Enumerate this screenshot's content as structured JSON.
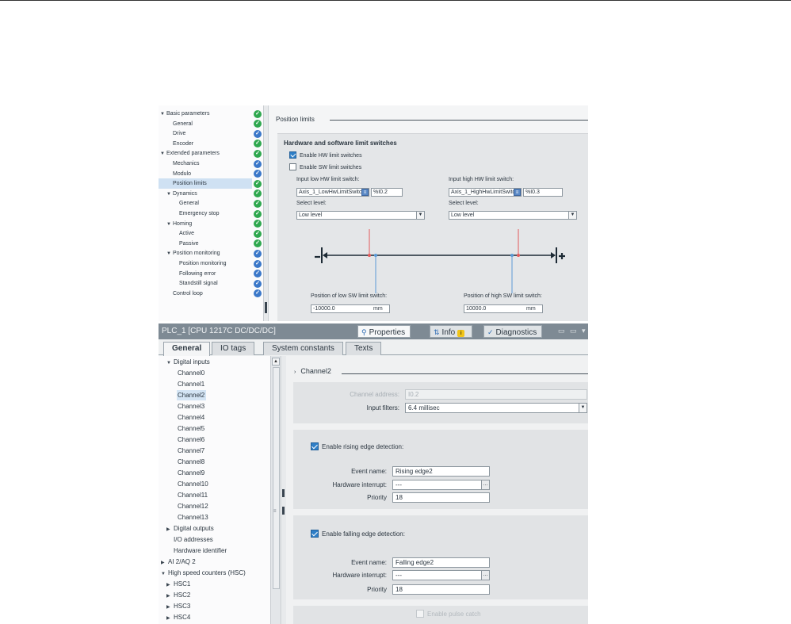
{
  "axis_config": {
    "tree": [
      {
        "label": "Basic parameters",
        "indent": 0,
        "toggle": "▼",
        "status": "green"
      },
      {
        "label": "General",
        "indent": 1,
        "toggle": "",
        "status": "green"
      },
      {
        "label": "Drive",
        "indent": 1,
        "toggle": "",
        "status": "blue"
      },
      {
        "label": "Encoder",
        "indent": 1,
        "toggle": "",
        "status": "green"
      },
      {
        "label": "Extended parameters",
        "indent": 0,
        "toggle": "▼",
        "status": "green"
      },
      {
        "label": "Mechanics",
        "indent": 1,
        "toggle": "",
        "status": "blue"
      },
      {
        "label": "Modulo",
        "indent": 1,
        "toggle": "",
        "status": "blue"
      },
      {
        "label": "Position limits",
        "indent": 1,
        "toggle": "",
        "status": "green",
        "selected": true
      },
      {
        "label": "Dynamics",
        "indent": 1,
        "toggle": "▼",
        "status": "green"
      },
      {
        "label": "General",
        "indent": 2,
        "toggle": "",
        "status": "green"
      },
      {
        "label": "Emergency stop",
        "indent": 2,
        "toggle": "",
        "status": "green"
      },
      {
        "label": "Homing",
        "indent": 1,
        "toggle": "▼",
        "status": "green"
      },
      {
        "label": "Active",
        "indent": 2,
        "toggle": "",
        "status": "green"
      },
      {
        "label": "Passive",
        "indent": 2,
        "toggle": "",
        "status": "green"
      },
      {
        "label": "Position monitoring",
        "indent": 1,
        "toggle": "▼",
        "status": "blue"
      },
      {
        "label": "Position monitoring",
        "indent": 2,
        "toggle": "",
        "status": "blue"
      },
      {
        "label": "Following error",
        "indent": 2,
        "toggle": "",
        "status": "blue"
      },
      {
        "label": "Standstill signal",
        "indent": 2,
        "toggle": "",
        "status": "blue"
      },
      {
        "label": "Control loop",
        "indent": 1,
        "toggle": "",
        "status": "blue"
      }
    ],
    "status_icons": {
      "green": "check-green-icon",
      "blue": "check-blue-icon"
    },
    "section_title": "Position limits",
    "group_title": "Hardware and software limit switches",
    "enable_hw": {
      "label": "Enable HW limit switches",
      "checked": true
    },
    "enable_sw": {
      "label": "Enable SW limit switches",
      "checked": false
    },
    "low_hw": {
      "label": "Input low HW limit switch:",
      "tag": "Axis_1_LowHwLimitSwitc",
      "address": "%I0.2",
      "level_label": "Select level:",
      "level": "Low level"
    },
    "high_hw": {
      "label": "Input high HW limit switch:",
      "tag": "Axis_1_HighHwLimitSwitc",
      "address": "%I0.3",
      "level_label": "Select level:",
      "level": "Low level"
    },
    "low_sw": {
      "label": "Position of low SW limit switch:",
      "value": "-10000.0",
      "unit": "mm"
    },
    "high_sw": {
      "label": "Position of high SW limit switch:",
      "value": "10000.0",
      "unit": "mm"
    },
    "colors": {
      "hw_marker": "#e25b5b",
      "sw_marker": "#5b9ad6"
    }
  },
  "properties": {
    "title": "PLC_1 [CPU 1217C DC/DC/DC]",
    "top_tabs": {
      "properties": "Properties",
      "info": "Info",
      "diagnostics": "Diagnostics"
    },
    "tabs": [
      "General",
      "IO tags",
      "System constants",
      "Texts"
    ],
    "tree": [
      {
        "label": "Digital inputs",
        "indent": 1,
        "toggle": "▼"
      },
      {
        "label": "Channel0",
        "indent": 3,
        "toggle": ""
      },
      {
        "label": "Channel1",
        "indent": 3,
        "toggle": ""
      },
      {
        "label": "Channel2",
        "indent": 3,
        "toggle": "",
        "selected": true
      },
      {
        "label": "Channel3",
        "indent": 3,
        "toggle": ""
      },
      {
        "label": "Channel4",
        "indent": 3,
        "toggle": ""
      },
      {
        "label": "Channel5",
        "indent": 3,
        "toggle": ""
      },
      {
        "label": "Channel6",
        "indent": 3,
        "toggle": ""
      },
      {
        "label": "Channel7",
        "indent": 3,
        "toggle": ""
      },
      {
        "label": "Channel8",
        "indent": 3,
        "toggle": ""
      },
      {
        "label": "Channel9",
        "indent": 3,
        "toggle": ""
      },
      {
        "label": "Channel10",
        "indent": 3,
        "toggle": ""
      },
      {
        "label": "Channel11",
        "indent": 3,
        "toggle": ""
      },
      {
        "label": "Channel12",
        "indent": 3,
        "toggle": ""
      },
      {
        "label": "Channel13",
        "indent": 3,
        "toggle": ""
      },
      {
        "label": "Digital outputs",
        "indent": 1,
        "toggle": "▶"
      },
      {
        "label": "I/O addresses",
        "indent": 1,
        "toggle": ""
      },
      {
        "label": "Hardware identifier",
        "indent": 1,
        "toggle": ""
      },
      {
        "label": "AI 2/AQ 2",
        "indent": 0,
        "toggle": "▶"
      },
      {
        "label": "High speed counters (HSC)",
        "indent": 0,
        "toggle": "▼"
      },
      {
        "label": "HSC1",
        "indent": 1,
        "toggle": "▶"
      },
      {
        "label": "HSC2",
        "indent": 1,
        "toggle": "▶"
      },
      {
        "label": "HSC3",
        "indent": 1,
        "toggle": "▶"
      },
      {
        "label": "HSC4",
        "indent": 1,
        "toggle": "▶"
      }
    ],
    "channel": {
      "title": "Channel2",
      "address_label": "Channel address:",
      "address": "I0.2",
      "filters_label": "Input filters:",
      "filters": "6.4 millisec",
      "rising": {
        "label": "Enable rising edge detection:",
        "event_label": "Event name:",
        "event": "Rising edge2",
        "hw_label": "Hardware interrupt:",
        "hw": "---",
        "priority_label": "Priority",
        "priority": "18"
      },
      "falling": {
        "label": "Enable falling edge detection:",
        "event_label": "Event name:",
        "event": "Falling edge2",
        "hw_label": "Hardware interrupt:",
        "hw": "---",
        "priority_label": "Priority",
        "priority": "18"
      },
      "pulse_catch": "Enable pulse catch"
    }
  }
}
